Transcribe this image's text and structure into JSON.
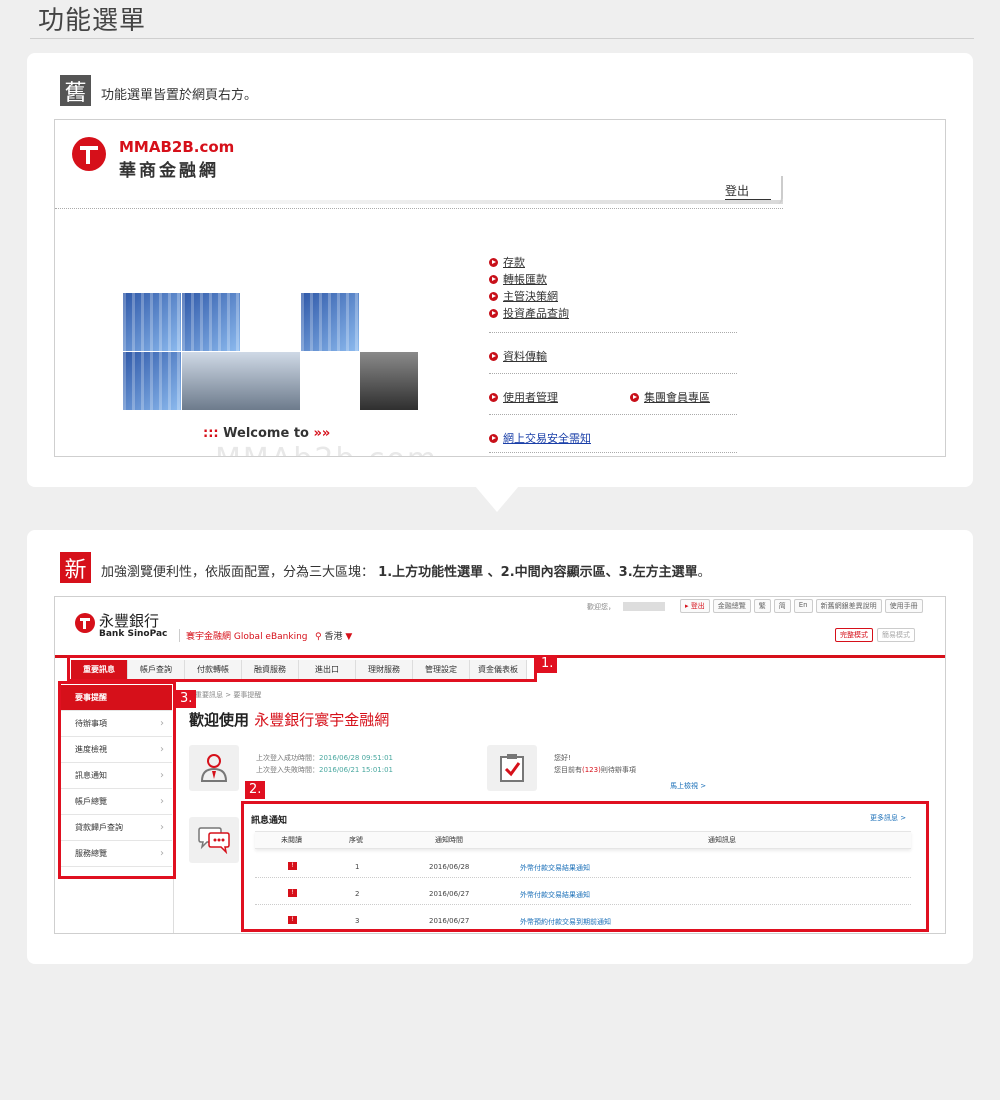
{
  "page_title": "功能選單",
  "old_section": {
    "tag": "舊",
    "caption": "功能選單皆置於網頁右方。",
    "brand_en": "MMAB2B.com",
    "brand_zh": "華商金融網",
    "logout": "登出",
    "welcome": "Welcome to",
    "welcome_mark": ":::",
    "welcome_arrow": "»»",
    "watermark": "MMAb2b.com",
    "menu": [
      "存款",
      "轉帳匯款",
      "主管決策網",
      "投資產品查詢",
      "資料傳輸",
      "使用者管理",
      "集團會員專區",
      "網上交易安全需知"
    ]
  },
  "new_section": {
    "tag": "新",
    "caption_prefix": "加強瀏覽便利性，依版面配置，分為三大區塊：",
    "caption_bold": "1.上方功能性選單 、2.中間內容顯示區、3.左方主選單",
    "caption_suffix": "。",
    "bank_zh": "永豐銀行",
    "bank_en": "Bank SinoPac",
    "ebanking": "寰宇金融網 Global eBanking",
    "region": "香港",
    "region_arrow": "▼",
    "greeting": "歡迎您，",
    "top_links": [
      "▸ 登出",
      "金融總覽",
      "繁",
      "简",
      "En",
      "新舊網銀差異說明",
      "使用手冊"
    ],
    "mode_buttons": [
      "完整模式",
      "簡易模式"
    ],
    "nav_items": [
      "重要訊息",
      "帳戶查詢",
      "付款轉帳",
      "融資服務",
      "進出口",
      "理財服務",
      "管理設定",
      "資金儀表板"
    ],
    "side_items": [
      "要事提醒",
      "待辦事項",
      "進度檢視",
      "訊息通知",
      "帳戶總覽",
      "貸款歸戶查詢",
      "服務總覽"
    ],
    "breadcrumb": "重要訊息 > 要事提醒",
    "welcome_prefix": "歡迎使用",
    "welcome_brand": "永豐銀行寰宇金融網",
    "login_success_label": "上次登入成功時間：",
    "login_success_time": "2016/06/28 09:51:01",
    "login_fail_label": "上次登入失敗時間：",
    "login_fail_time": "2016/06/21 15:01:01",
    "hello": "您好!",
    "todo_prefix": "您目前有",
    "todo_count": "(123)",
    "todo_suffix": "則待辦事項",
    "goto": "馬上檢視 >",
    "notice_title": "訊息通知",
    "more": "更多訊息 >",
    "table": {
      "headers": [
        "未閱讀",
        "序號",
        "通知時間",
        "通知訊息"
      ],
      "rows": [
        {
          "no": "1",
          "date": "2016/06/28",
          "msg": "外幣付款交易結果通知"
        },
        {
          "no": "2",
          "date": "2016/06/27",
          "msg": "外幣付款交易結果通知"
        },
        {
          "no": "3",
          "date": "2016/06/27",
          "msg": "外幣預約付款交易到期前通知"
        }
      ]
    },
    "flag_glyph": "!",
    "labels": [
      "1.",
      "2.",
      "3."
    ]
  },
  "colors": {
    "brand_red": "#d6101a",
    "highlight_red": "#e01020",
    "link_blue": "#1a6fb8"
  }
}
